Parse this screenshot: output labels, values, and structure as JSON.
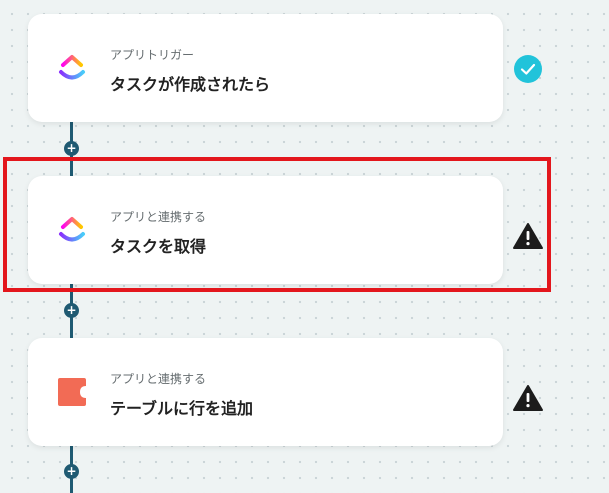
{
  "flow": {
    "steps": [
      {
        "subtitle": "アプリトリガー",
        "title": "タスクが作成されたら",
        "app_icon": "clickup-logo-icon",
        "status": "success"
      },
      {
        "subtitle": "アプリと連携する",
        "title": "タスクを取得",
        "app_icon": "clickup-logo-icon",
        "status": "warning"
      },
      {
        "subtitle": "アプリと連携する",
        "title": "テーブルに行を追加",
        "app_icon": "table-app-logo-icon",
        "status": "warning"
      }
    ],
    "add_step_symbol": "+"
  },
  "colors": {
    "connector": "#1f5a72",
    "success": "#21c3da",
    "warning": "#1c1c1c",
    "highlight": "#e3161c",
    "table_app": "#f26b55"
  }
}
